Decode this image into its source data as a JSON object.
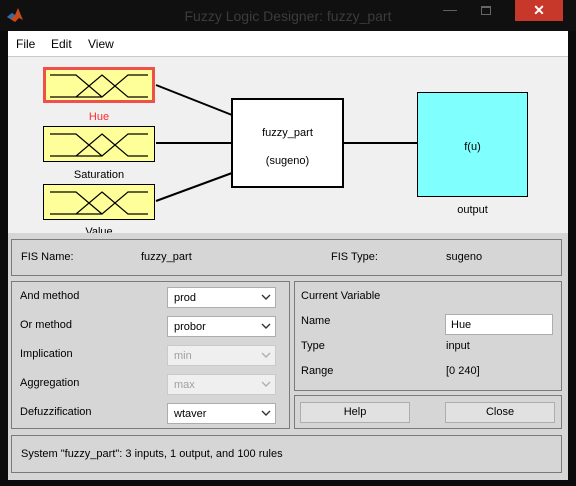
{
  "window": {
    "title": "Fuzzy Logic Designer: fuzzy_part",
    "minimize_glyph": "—",
    "close_glyph": "✕",
    "app_icon": "matlab-icon"
  },
  "menu": [
    {
      "label": "File"
    },
    {
      "label": "Edit"
    },
    {
      "label": "View"
    }
  ],
  "diagram": {
    "inputs": [
      {
        "name": "Hue",
        "selected": true
      },
      {
        "name": "Saturation",
        "selected": false
      },
      {
        "name": "Value",
        "selected": false
      }
    ],
    "system": {
      "name": "fuzzy_part",
      "type_label": "(sugeno)"
    },
    "output": {
      "function": "f(u)",
      "name": "output"
    },
    "colors": {
      "input_fill": "#ffff99",
      "selection": "#f0504a",
      "output_fill": "#80ffff"
    }
  },
  "fis": {
    "name_label": "FIS Name:",
    "name_value": "fuzzy_part",
    "type_label": "FIS Type:",
    "type_value": "sugeno"
  },
  "methods": {
    "and": {
      "label": "And method",
      "value": "prod",
      "enabled": true
    },
    "or": {
      "label": "Or method",
      "value": "probor",
      "enabled": true
    },
    "implication": {
      "label": "Implication",
      "value": "min",
      "enabled": false
    },
    "aggregation": {
      "label": "Aggregation",
      "value": "max",
      "enabled": false
    },
    "defuzzification": {
      "label": "Defuzzification",
      "value": "wtaver",
      "enabled": true
    }
  },
  "current_variable": {
    "heading": "Current Variable",
    "name_label": "Name",
    "name_value": "Hue",
    "type_label": "Type",
    "type_value": "input",
    "range_label": "Range",
    "range_value": "[0 240]"
  },
  "buttons": {
    "help": "Help",
    "close": "Close"
  },
  "status": "System \"fuzzy_part\": 3 inputs, 1 output, and 100 rules"
}
